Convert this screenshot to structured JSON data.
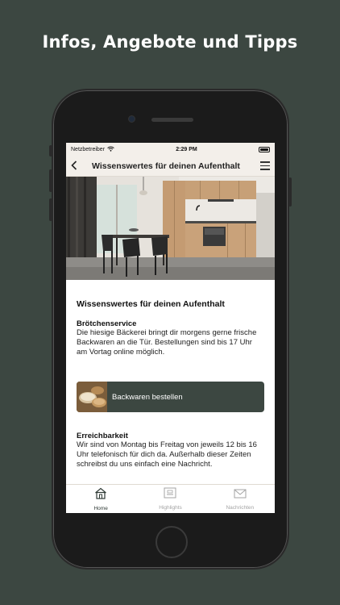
{
  "headline": "Infos, Angebote und Tipps",
  "status": {
    "carrier": "Netzbetreiber",
    "time": "2:29 PM"
  },
  "nav": {
    "title": "Wissenswertes für deinen Aufenthalt"
  },
  "content": {
    "section_title": "Wissenswertes für deinen Aufenthalt",
    "bread_title": "Brötchenservice",
    "bread_text": "Die hiesige Bäckerei bringt dir morgens gerne frische Backwaren an die Tür. Bestellungen sind bis 17 Uhr am Vortag online möglich.",
    "cta_label": "Backwaren bestellen",
    "reach_title": "Erreichbarkeit",
    "reach_text": "Wir sind von Montag bis Freitag von jeweils 12 bis 16 Uhr telefonisch für dich da. Außerhalb dieser Zeiten schreibst du uns einfach eine Nachricht."
  },
  "tabs": [
    {
      "label": "Home",
      "icon": "home-icon",
      "active": true
    },
    {
      "label": "Highlights",
      "icon": "highlights-icon",
      "active": false
    },
    {
      "label": "Nachrichten",
      "icon": "mail-icon",
      "active": false
    }
  ],
  "colors": {
    "accent": "#3c4741",
    "background": "#3c4741",
    "header": "#f3efea"
  }
}
